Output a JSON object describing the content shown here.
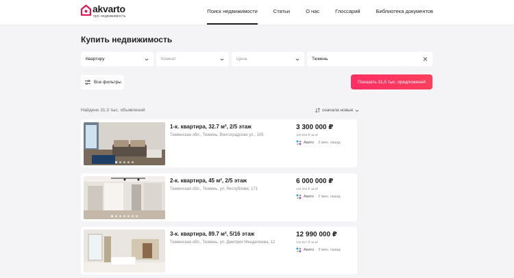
{
  "brand": {
    "name": "akvarto",
    "tagline": "про недвижимость",
    "color": "#e8124f"
  },
  "nav": [
    {
      "label": "Поиск недвижимости",
      "active": true
    },
    {
      "label": "Статьи",
      "active": false
    },
    {
      "label": "О нас",
      "active": false
    },
    {
      "label": "Глоссарий",
      "active": false
    },
    {
      "label": "Библиотека документов",
      "active": false
    }
  ],
  "page": {
    "title": "Купить недвижимость"
  },
  "filters": {
    "type": {
      "value": "Квартиру"
    },
    "rooms": {
      "placeholder": "Комнат"
    },
    "price": {
      "placeholder": "Цена"
    },
    "city": {
      "value": "Тюмень"
    },
    "all_filters_label": "Все фильтры",
    "show_button_label": "Показать 31,5 тыс. предложений"
  },
  "results": {
    "found_text": "Найдено 31.3 тыс. объявлений",
    "sort_label": "сначала новые"
  },
  "listings": [
    {
      "title": "1-к. квартира, 32.7 м², 2/5 этаж",
      "address": "Тюменская обл., Тюмень, Волгоградская ул., 105",
      "price": "3 300 000 ₽",
      "price_per_m2": "100 918 ₽ за м²",
      "source": "Авито",
      "posted": "2 мин. назад"
    },
    {
      "title": "2-к. квартира, 45 м², 2/5 этаж",
      "address": "Тюменская обл., Тюмень, ул. Республики, 171",
      "price": "6 000 000 ₽",
      "price_per_m2": "133 334 ₽ за м²",
      "source": "Авито",
      "posted": "2 мин. назад"
    },
    {
      "title": "3-к. квартира, 89.7 м², 5/16 этаж",
      "address": "Тюменская обл., Тюмень, ул. Дмитрия Менделеева, 12",
      "price": "12 990 000 ₽",
      "price_per_m2": "144 817 ₽ за м²",
      "source": "Авито",
      "posted": "3 мин. назад"
    }
  ]
}
